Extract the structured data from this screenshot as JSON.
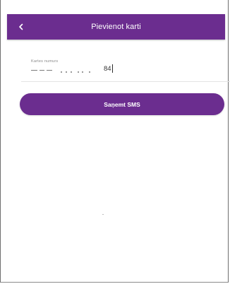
{
  "header": {
    "title": "Pievienot karti",
    "back_icon": "chevron-left-icon"
  },
  "form": {
    "card_number_label": "Kartes numurs",
    "card_number_value": "84"
  },
  "actions": {
    "get_sms_label": "Saņemt SMS"
  },
  "colors": {
    "brand_purple": "#6b2d8f",
    "on_brand": "#ffffff",
    "divider": "#e3e3e3"
  }
}
